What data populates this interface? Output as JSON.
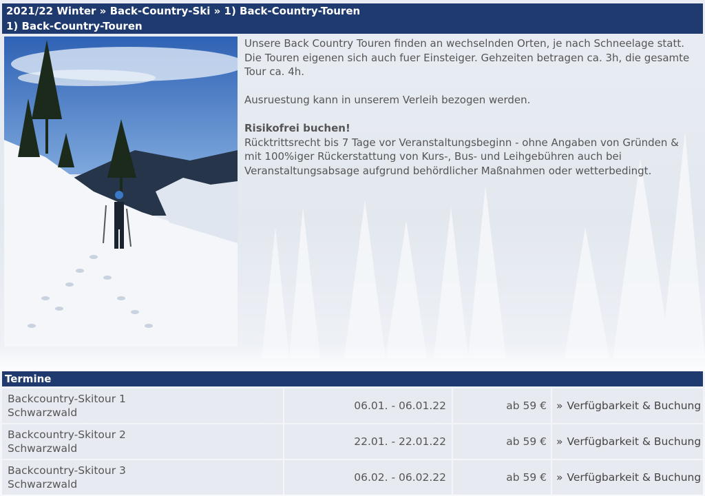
{
  "header": {
    "breadcrumb": "2021/22 Winter » Back-Country-Ski » 1) Back-Country-Touren",
    "title": "1) Back-Country-Touren"
  },
  "description": {
    "p1": "Unsere Back Country Touren finden an wechselnden Orten, je nach Schneelage statt.",
    "p2": "Die Touren eigenen sich auch fuer Einsteiger. Gehzeiten betragen ca. 3h, die gesamte Tour ca. 4h.",
    "p3": "Ausruestung kann in unserem Verleih bezogen werden.",
    "risk_title": "Risikofrei buchen!",
    "risk_text": "Rücktrittsrecht bis 7 Tage vor Veranstaltungsbeginn - ohne Angaben von Gründen & mit 100%iger Rückerstattung von Kurs-, Bus- und Leihgebühren auch bei Veranstaltungsabsage aufgrund behördlicher Maßnahmen oder wetterbedingt."
  },
  "termine": {
    "heading": "Termine",
    "rows": [
      {
        "name": "Backcountry-Skitour 1",
        "place": "Schwarzwald",
        "dates": "06.01. - 06.01.22",
        "price": "ab 59 €",
        "link_arrow": "»",
        "link": "Verfügbarkeit & Buchung"
      },
      {
        "name": "Backcountry-Skitour 2",
        "place": "Schwarzwald",
        "dates": "22.01. - 22.01.22",
        "price": "ab 59 €",
        "link_arrow": "»",
        "link": "Verfügbarkeit & Buchung"
      },
      {
        "name": "Backcountry-Skitour 3",
        "place": "Schwarzwald",
        "dates": "06.02. - 06.02.22",
        "price": "ab 59 €",
        "link_arrow": "»",
        "link": "Verfügbarkeit & Buchung"
      }
    ]
  },
  "colors": {
    "header_bg": "#1f3a6e",
    "row_bg": "#e7eaf0",
    "text": "#555555"
  }
}
